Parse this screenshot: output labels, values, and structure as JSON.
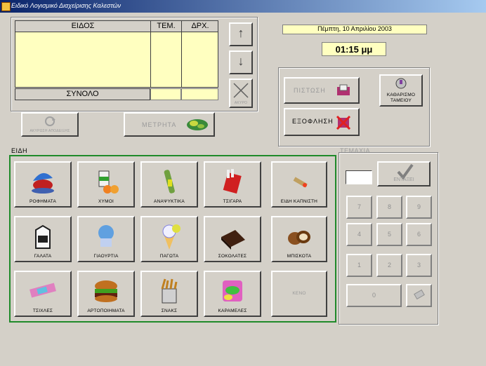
{
  "window": {
    "title": "Ειδικό Λογισμικό Διαχείρισης Καλεστών"
  },
  "order_table": {
    "headers": [
      "ΕΙΔΟΣ",
      "ΤΕΜ.",
      "ΔΡΧ."
    ],
    "total_label": "ΣΥΝΟΛΟ"
  },
  "nav": {
    "up_label": "↑",
    "down_label": "↓",
    "cancel_label": "ΑΚΥΡΟ"
  },
  "datetime": {
    "date": "Πέμπτη, 10 Απριλίου 2003",
    "time": "01:15 μμ"
  },
  "payment": {
    "credit_label": "ΠΙΣΤΩΣΗ",
    "settle_label": "ΕΞΟΦΛΗΣΗ",
    "clean_register_label": "ΚΑΘΑΡΙΣΜΟ ΤΑΜΕΙΟΥ"
  },
  "actions": {
    "cancel_receipt_label": "ΑΚΥΡΩΣΗ ΑΠΟΔΕΙΞΗΣ",
    "cash_label": "ΜΕΤΡΗΤΑ"
  },
  "categories_section": {
    "title": "ΕΙΔΗ"
  },
  "categories": [
    {
      "label": "ΡΟΦΗΜΑΤΑ",
      "icon": "hot-drinks-icon"
    },
    {
      "label": "ΧΥΜΟΙ",
      "icon": "juice-icon"
    },
    {
      "label": "ΑΝΑΨΥΚΤΙΚΑ",
      "icon": "soft-drinks-icon"
    },
    {
      "label": "ΤΣΙΓΑΡΑ",
      "icon": "cigarettes-icon"
    },
    {
      "label": "ΕΙΔΗ ΚΑΠΝΙΣΤΗ",
      "icon": "smoker-items-icon"
    },
    {
      "label": "ΓΑΛΑΤΑ",
      "icon": "milk-icon"
    },
    {
      "label": "ΓΙΑΟΥΡΤΙΑ",
      "icon": "yogurt-icon"
    },
    {
      "label": "ΠΑΓΩΤΑ",
      "icon": "ice-cream-icon"
    },
    {
      "label": "ΣΟΚΟΛΑΤΕΣ",
      "icon": "chocolate-icon"
    },
    {
      "label": "ΜΠΙΣΚΟΤΑ",
      "icon": "biscuits-icon"
    },
    {
      "label": "ΤΣΙΧΛΕΣ",
      "icon": "gum-icon"
    },
    {
      "label": "ΑΡΤΟΠΟΙΗΜΑΤΑ",
      "icon": "bakery-icon"
    },
    {
      "label": "ΣΝΑΚΣ",
      "icon": "snacks-icon"
    },
    {
      "label": "ΚΑΡΑΜΕΛΕΣ",
      "icon": "candy-icon"
    },
    {
      "label": "ΚΕΝΟ",
      "icon": ""
    }
  ],
  "keypad": {
    "title": "ΤΕΜΑΧΙΑ",
    "enter_label": "ΕΝΤΑΞΕΙ",
    "keys": [
      "7",
      "8",
      "9",
      "4",
      "5",
      "6",
      "1",
      "2",
      "3",
      "0"
    ]
  },
  "colors": {
    "accent_green": "#1f8a2a",
    "yellow_field": "#ffffc0",
    "title_blue": "#0a246a"
  }
}
